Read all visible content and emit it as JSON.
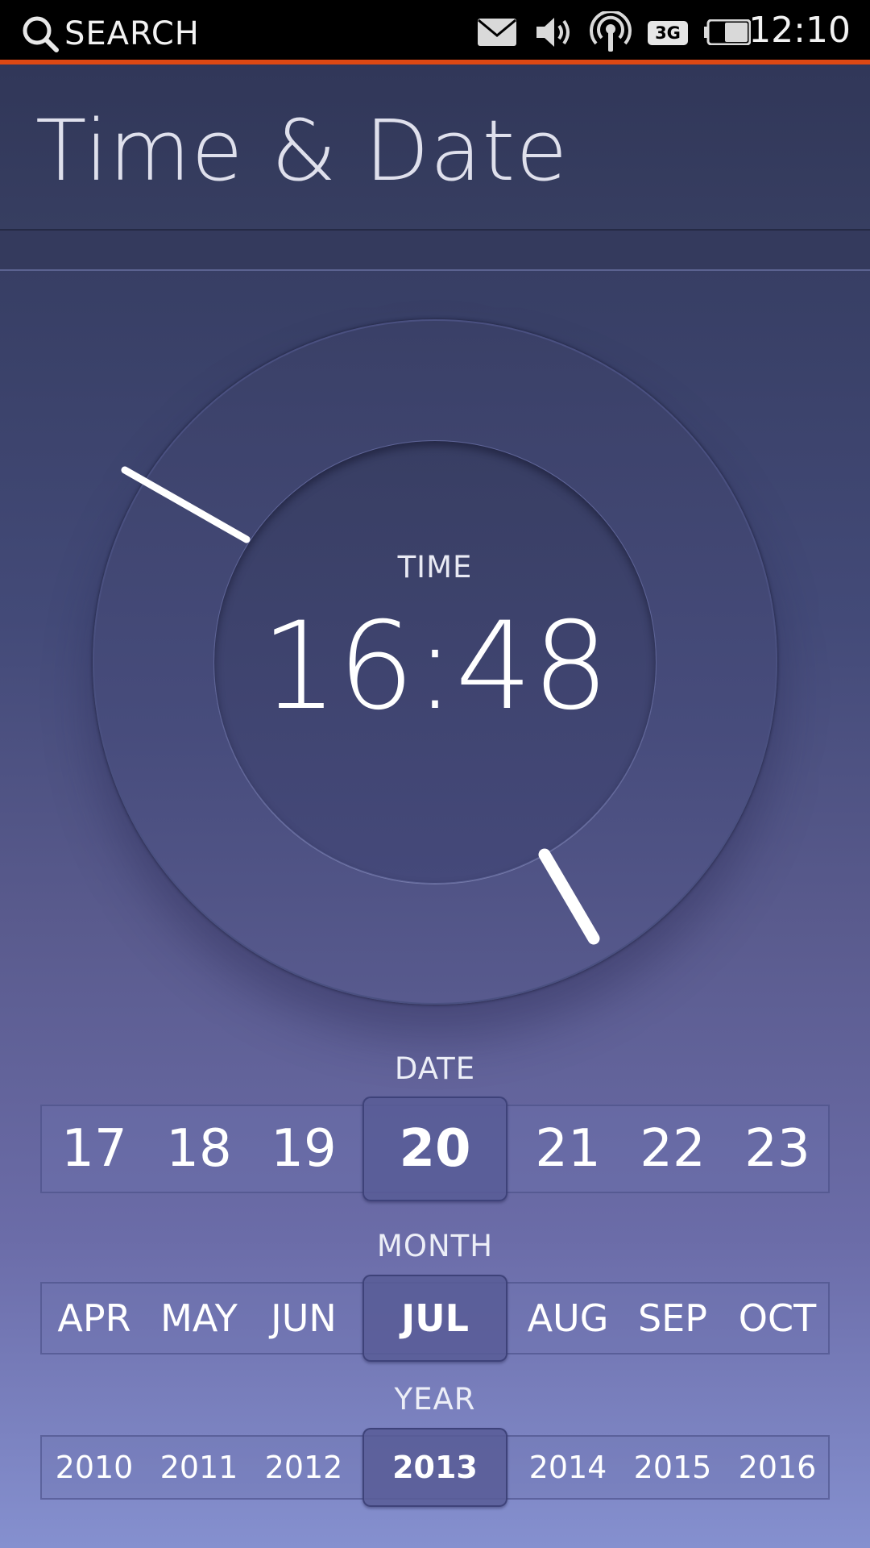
{
  "status_bar": {
    "search_label": "SEARCH",
    "network_badge": "3G",
    "clock": "12:10",
    "icons": [
      "search-icon",
      "envelope-icon",
      "speaker-icon",
      "broadcast-icon",
      "battery-icon"
    ],
    "accent_color": "#dd4814"
  },
  "header": {
    "title": "Time & Date"
  },
  "time": {
    "caption": "TIME",
    "value": "16:48"
  },
  "date": {
    "caption": "DATE",
    "days": [
      "17",
      "18",
      "19",
      "20",
      "21",
      "22",
      "23"
    ],
    "selected": "20"
  },
  "month": {
    "caption": "MONTH",
    "months": [
      "APR",
      "MAY",
      "JUN",
      "JUL",
      "AUG",
      "SEP",
      "OCT"
    ],
    "selected": "JUL"
  },
  "year": {
    "caption": "YEAR",
    "years": [
      "2010",
      "2011",
      "2012",
      "2013",
      "2014",
      "2015",
      "2016"
    ],
    "selected": "2013"
  }
}
